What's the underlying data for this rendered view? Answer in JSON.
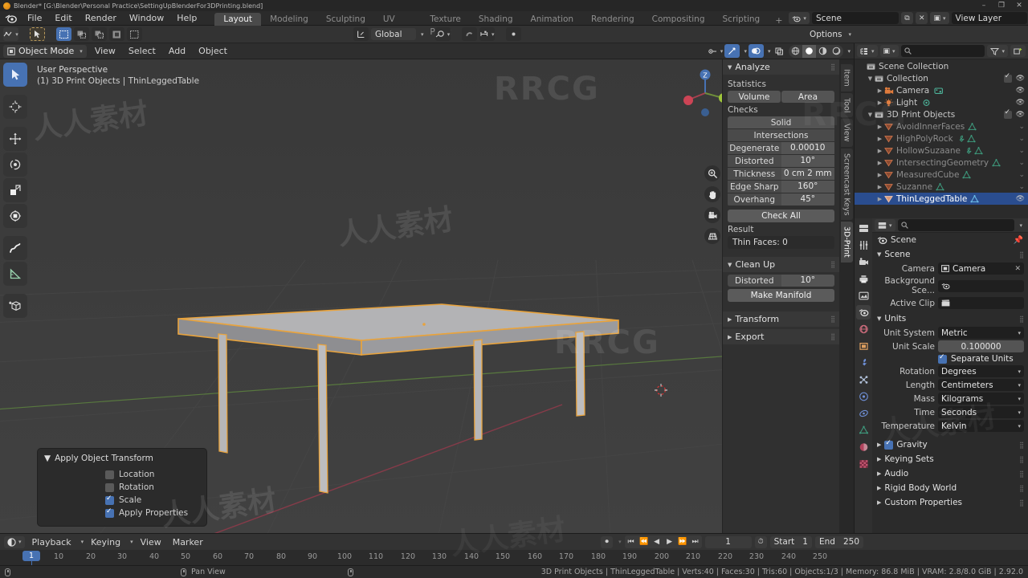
{
  "window": {
    "title": "Blender* [G:\\Blender\\Personal Practice\\SettingUpBlenderFor3DPrinting.blend]",
    "minimize": "–",
    "maximize": "❐",
    "close": "✕"
  },
  "topbar": {
    "menus": [
      "File",
      "Edit",
      "Render",
      "Window",
      "Help"
    ],
    "workspaces": [
      "Layout",
      "Modeling",
      "Sculpting",
      "UV Editing",
      "Texture Paint",
      "Shading",
      "Animation",
      "Rendering",
      "Compositing",
      "Scripting"
    ],
    "active_workspace": "Layout",
    "add_workspace": "+",
    "scene_label": "Scene",
    "view_layer_label": "View Layer"
  },
  "tool_header": {
    "options_label": "Options"
  },
  "viewport_header": {
    "mode": "Object Mode",
    "menus": [
      "View",
      "Select",
      "Add",
      "Object"
    ],
    "transform_orientation": "Global"
  },
  "viewport": {
    "info_line1": "User Perspective",
    "info_line2": "(1) 3D Print Objects | ThinLeggedTable",
    "gizmo_axis_z": "Z"
  },
  "sidebar": {
    "tabs": [
      "Item",
      "Tool",
      "View",
      "Screencast Keys",
      "3D-Print"
    ],
    "active_tab": "3D-Print"
  },
  "print3d": {
    "analyze_title": "Analyze",
    "statistics_label": "Statistics",
    "stat_buttons": [
      "Volume",
      "Area"
    ],
    "checks_label": "Checks",
    "check_rows": [
      {
        "name": "Solid",
        "value": ""
      },
      {
        "name": "Intersections",
        "value": ""
      },
      {
        "name": "Degenerate",
        "value": "0.00010"
      },
      {
        "name": "Distorted",
        "value": "10°"
      },
      {
        "name": "Thickness",
        "value": "0 cm 2 mm"
      },
      {
        "name": "Edge Sharp",
        "value": "160°"
      },
      {
        "name": "Overhang",
        "value": "45°"
      }
    ],
    "check_all_label": "Check All",
    "result_label": "Result",
    "result_value": "Thin Faces: 0",
    "cleanup_title": "Clean Up",
    "cleanup_distorted_label": "Distorted",
    "cleanup_distorted_value": "10°",
    "make_manifold_label": "Make Manifold",
    "transform_title": "Transform",
    "export_title": "Export"
  },
  "redo_panel": {
    "title": "Apply Object Transform",
    "options": [
      {
        "label": "Location",
        "checked": false
      },
      {
        "label": "Rotation",
        "checked": false
      },
      {
        "label": "Scale",
        "checked": true
      },
      {
        "label": "Apply Properties",
        "checked": true
      }
    ]
  },
  "outliner": {
    "rows": [
      {
        "indent": 0,
        "tri": "",
        "icon": "collection-icon",
        "name": "Scene Collection",
        "dim": false,
        "selected": false,
        "checkbox": false,
        "eye": false
      },
      {
        "indent": 1,
        "tri": "▼",
        "icon": "collection-icon",
        "name": "Collection",
        "dim": false,
        "selected": false,
        "checkbox": true,
        "eye": true
      },
      {
        "indent": 2,
        "tri": "▶",
        "icon": "camera-icon",
        "name": "Camera",
        "dim": false,
        "selected": false,
        "checkbox": false,
        "eye": true
      },
      {
        "indent": 2,
        "tri": "▶",
        "icon": "light-icon",
        "name": "Light",
        "dim": false,
        "selected": false,
        "checkbox": false,
        "eye": true
      },
      {
        "indent": 1,
        "tri": "▼",
        "icon": "collection-icon",
        "name": "3D Print Objects",
        "dim": false,
        "selected": false,
        "checkbox": true,
        "eye": true
      },
      {
        "indent": 2,
        "tri": "▶",
        "icon": "mesh-icon",
        "name": "AvoidInnerFaces",
        "dim": true,
        "selected": false,
        "checkbox": false,
        "eye": false
      },
      {
        "indent": 2,
        "tri": "▶",
        "icon": "mesh-icon",
        "name": "HighPolyRock",
        "dim": true,
        "selected": false,
        "checkbox": false,
        "eye": false
      },
      {
        "indent": 2,
        "tri": "▶",
        "icon": "mesh-icon",
        "name": "HollowSuzaane",
        "dim": true,
        "selected": false,
        "checkbox": false,
        "eye": false
      },
      {
        "indent": 2,
        "tri": "▶",
        "icon": "mesh-icon",
        "name": "IntersectingGeometry",
        "dim": true,
        "selected": false,
        "checkbox": false,
        "eye": false
      },
      {
        "indent": 2,
        "tri": "▶",
        "icon": "mesh-icon",
        "name": "MeasuredCube",
        "dim": true,
        "selected": false,
        "checkbox": false,
        "eye": false
      },
      {
        "indent": 2,
        "tri": "▶",
        "icon": "mesh-icon",
        "name": "Suzanne",
        "dim": true,
        "selected": false,
        "checkbox": false,
        "eye": false
      },
      {
        "indent": 2,
        "tri": "▶",
        "icon": "mesh-icon",
        "name": "ThinLeggedTable",
        "dim": false,
        "selected": true,
        "checkbox": false,
        "eye": true
      }
    ]
  },
  "properties": {
    "breadcrumb": "Scene",
    "scene_section": "Scene",
    "camera_label": "Camera",
    "camera_value": "Camera",
    "background_scene_label": "Background Sce...",
    "active_clip_label": "Active Clip",
    "units_section": "Units",
    "unit_system_label": "Unit System",
    "unit_system_value": "Metric",
    "unit_scale_label": "Unit Scale",
    "unit_scale_value": "0.100000",
    "separate_units_label": "Separate Units",
    "separate_units_checked": true,
    "rotation_label": "Rotation",
    "rotation_value": "Degrees",
    "length_label": "Length",
    "length_value": "Centimeters",
    "mass_label": "Mass",
    "mass_value": "Kilograms",
    "time_label": "Time",
    "time_value": "Seconds",
    "temperature_label": "Temperature",
    "temperature_value": "Kelvin",
    "collapsed": [
      {
        "label": "Gravity",
        "checkbox": true
      },
      {
        "label": "Keying Sets",
        "checkbox": false
      },
      {
        "label": "Audio",
        "checkbox": false
      },
      {
        "label": "Rigid Body World",
        "checkbox": false
      },
      {
        "label": "Custom Properties",
        "checkbox": false
      }
    ]
  },
  "timeline": {
    "menus": [
      "Playback",
      "Keying",
      "View",
      "Marker"
    ],
    "ticks": [
      "10",
      "20",
      "30",
      "40",
      "50",
      "60",
      "70",
      "80",
      "90",
      "100",
      "110",
      "120",
      "130",
      "140",
      "150",
      "160",
      "170",
      "180",
      "190",
      "200",
      "210",
      "220",
      "230",
      "240",
      "250"
    ],
    "current_frame": "1",
    "frame_field": "1",
    "start_label": "Start",
    "start_value": "1",
    "end_label": "End",
    "end_value": "250"
  },
  "statusbar": {
    "pan_view": "Pan View",
    "info": "3D Print Objects | ThinLeggedTable | Verts:40 | Faces:30 | Tris:60 | Objects:1/3 | Memory: 86.8 MiB | VRAM: 2.8/8.0 GiB | 2.92.0"
  },
  "watermarks": {
    "rrcg": "RRCG",
    "cn": "人人素材"
  },
  "colors": {
    "accent_blue": "#4772b3",
    "selected_outline": "#e8a33d",
    "axis_x": "#8a3b4a",
    "axis_y": "#5b7f3f",
    "viewport_bg": "#3d3d3d"
  }
}
